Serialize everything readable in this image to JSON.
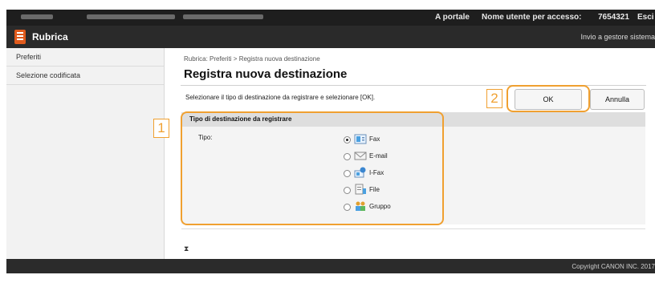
{
  "topbar": {
    "portal_link": "A portale",
    "user_label": "Nome utente per accesso:",
    "user_value": "7654321",
    "logout_link": "Esci"
  },
  "app": {
    "title": "Rubrica",
    "send_to_admin": "Invio a gestore sistema"
  },
  "sidebar": {
    "items": [
      {
        "label": "Preferiti"
      },
      {
        "label": "Selezione codificata"
      }
    ]
  },
  "main": {
    "breadcrumb": "Rubrica: Preferiti > Registra nuova destinazione",
    "title": "Registra nuova destinazione",
    "instruction": "Selezionare il tipo di destinazione da registrare e selezionare [OK].",
    "ok_label": "OK",
    "cancel_label": "Annulla",
    "section_title": "Tipo di destinazione da registrare",
    "type_label": "Tipo:",
    "options": [
      {
        "label": "Fax",
        "icon": "fax-icon",
        "selected": true
      },
      {
        "label": "E-mail",
        "icon": "email-icon",
        "selected": false
      },
      {
        "label": "I-Fax",
        "icon": "ifax-icon",
        "selected": false
      },
      {
        "label": "File",
        "icon": "file-icon",
        "selected": false
      },
      {
        "label": "Gruppo",
        "icon": "group-icon",
        "selected": false
      }
    ],
    "hourglass": "⧗"
  },
  "callouts": [
    "1",
    "2"
  ],
  "footer": {
    "copyright": "Copyright CANON INC. 2017"
  },
  "colors": {
    "highlight": "#f0a030",
    "logo": "#e05a1c"
  }
}
